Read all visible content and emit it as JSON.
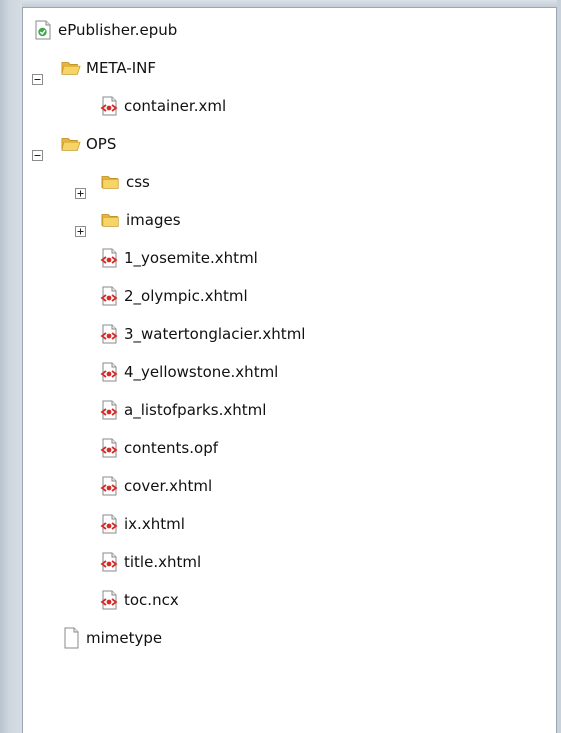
{
  "tree": {
    "root": {
      "label": "ePublisher.epub"
    },
    "meta_inf": {
      "label": "META-INF",
      "expanded": true
    },
    "container": {
      "label": "container.xml"
    },
    "ops": {
      "label": "OPS",
      "expanded": true
    },
    "css": {
      "label": "css",
      "expanded": false
    },
    "images": {
      "label": "images",
      "expanded": false
    },
    "files": [
      {
        "label": "1_yosemite.xhtml"
      },
      {
        "label": "2_olympic.xhtml"
      },
      {
        "label": "3_watertonglacier.xhtml"
      },
      {
        "label": "4_yellowstone.xhtml"
      },
      {
        "label": "a_listofparks.xhtml"
      },
      {
        "label": "contents.opf"
      },
      {
        "label": "cover.xhtml"
      },
      {
        "label": "ix.xhtml"
      },
      {
        "label": "title.xhtml"
      },
      {
        "label": "toc.ncx"
      }
    ],
    "mimetype": {
      "label": "mimetype"
    }
  },
  "icons": {
    "epub": "epub-file-icon",
    "folder": "folder-open-icon",
    "xml": "xml-file-icon",
    "plain": "plain-file-icon",
    "expand": "plus-box-icon",
    "collapse": "minus-box-icon"
  },
  "colors": {
    "folder": "#f3c84a",
    "xml_red": "#d42a2a",
    "epub_green": "#3fa64a"
  }
}
